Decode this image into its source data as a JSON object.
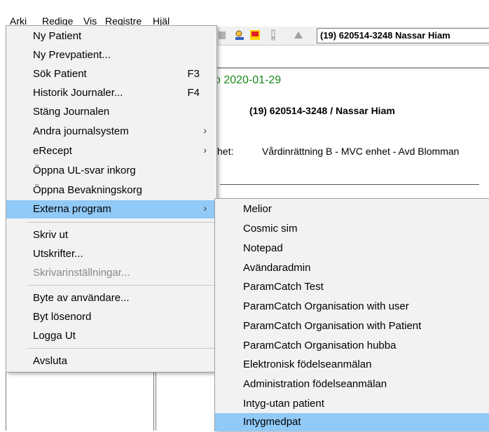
{
  "menubar": {
    "items": [
      "Arki",
      "Redige",
      "Vis",
      "Registre",
      "Hjäl"
    ]
  },
  "toolbar": {
    "patient_selector": "(19) 620514-3248 Nassar Hiam"
  },
  "document": {
    "date_line": "o 2020-01-29",
    "patient_line": "(19) 620514-3248 / Nassar Hiam",
    "unit_label": "het:",
    "unit_value": "Vårdinrättning B - MVC enhet - Avd Blomman"
  },
  "file_menu": {
    "items": [
      {
        "label": "Ny Patient"
      },
      {
        "label": "Ny Prevpatient..."
      },
      {
        "label": "Sök Patient",
        "shortcut": "F3"
      },
      {
        "label": "Historik Journaler...",
        "shortcut": "F4"
      },
      {
        "label": "Stäng Journalen"
      },
      {
        "label": "Andra journalsystem",
        "submenu": true
      },
      {
        "label": "eRecept",
        "submenu": true
      },
      {
        "label": "Öppna UL-svar inkorg"
      },
      {
        "label": "Öppna Bevakningskorg"
      },
      {
        "label": "Externa program",
        "submenu": true,
        "highlighted": true
      },
      {
        "label": "Skriv ut"
      },
      {
        "label": "Utskrifter..."
      },
      {
        "label": "Skrivarinställningar...",
        "disabled": true
      },
      {
        "label": "Byte av användare..."
      },
      {
        "label": "Byt lösenord"
      },
      {
        "label": "Logga Ut"
      },
      {
        "label": "Avsluta"
      }
    ]
  },
  "externa_submenu": {
    "items": [
      "Melior",
      "Cosmic sim",
      "Notepad",
      "Avändaradmin",
      "ParamCatch Test",
      "ParamCatch Organisation with user",
      "ParamCatch Organisation with Patient",
      "ParamCatch Organisation hubba",
      "Elektronisk födelseanmälan",
      "Administration födelseanmälan",
      "Intyg-utan patient",
      "Intygmedpat"
    ],
    "highlighted": "Intygmedpat"
  },
  "colors": {
    "highlight": "#91c9f7",
    "date_green": "#1a8a1a",
    "menu_bg": "#f2f2f2"
  }
}
